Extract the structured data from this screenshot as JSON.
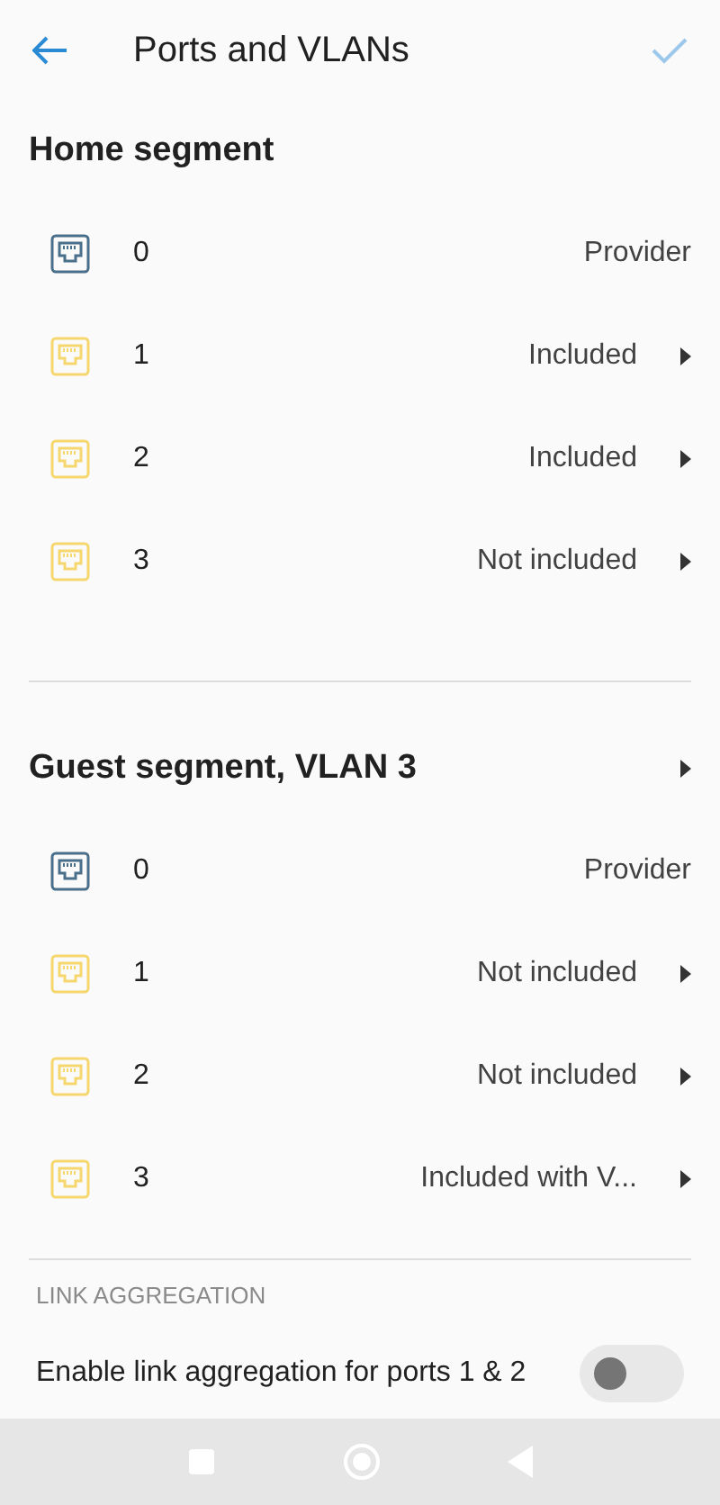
{
  "header": {
    "title": "Ports and VLANs"
  },
  "segments": [
    {
      "title": "Home segment",
      "expandable": false,
      "ports": [
        {
          "number": "0",
          "kind": "provider",
          "status": "Provider"
        },
        {
          "number": "1",
          "kind": "lan",
          "status": "Included"
        },
        {
          "number": "2",
          "kind": "lan",
          "status": "Included"
        },
        {
          "number": "3",
          "kind": "lan",
          "status": "Not included"
        }
      ]
    },
    {
      "title": "Guest segment, VLAN 3",
      "expandable": true,
      "ports": [
        {
          "number": "0",
          "kind": "provider",
          "status": "Provider"
        },
        {
          "number": "1",
          "kind": "lan",
          "status": "Not included"
        },
        {
          "number": "2",
          "kind": "lan",
          "status": "Not included"
        },
        {
          "number": "3",
          "kind": "lan",
          "status": "Included with V..."
        }
      ]
    }
  ],
  "link_aggregation": {
    "heading": "LINK AGGREGATION",
    "label": "Enable link aggregation for ports 1 & 2",
    "on": false
  }
}
